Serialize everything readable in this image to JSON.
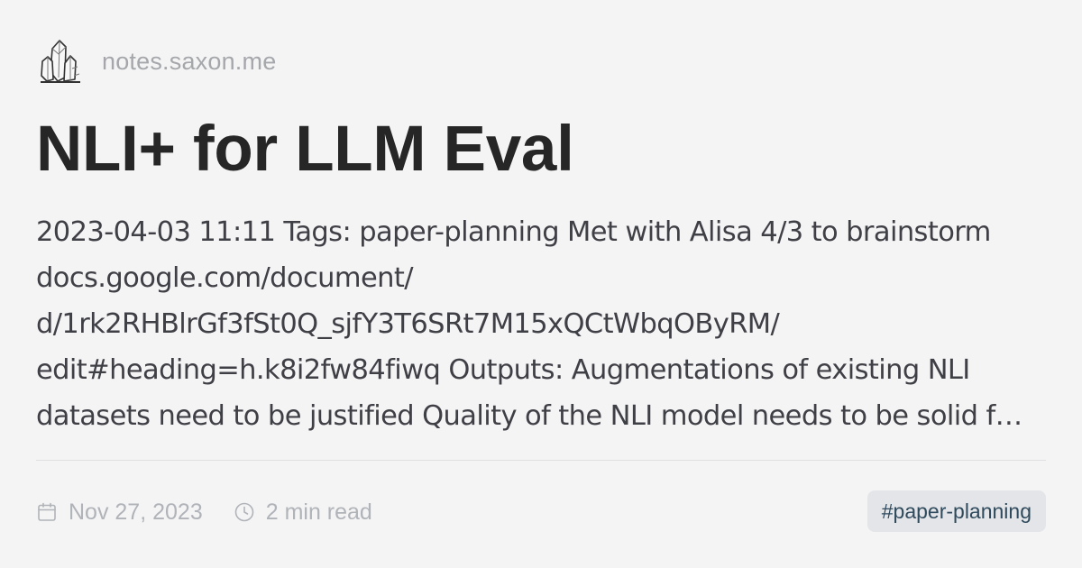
{
  "site": {
    "name": "notes.saxon.me",
    "logo_icon": "crystal-cluster-icon"
  },
  "post": {
    "title": "NLI+ for LLM Eval",
    "excerpt": "2023-04-03 11:11 Tags: paper-planning Met with Alisa 4/3 to brainstorm docs.google.com/document/ d/1rk2RHBlrGf3fSt0Q_sjfY3T6SRt7M15xQCtWbqOByRM/ edit#heading=h.k8i2fw84fiwq Outputs: Augmentations of existing NLI datasets need to be justified Quality of the NLI model needs to be solid f…",
    "date": "Nov 27, 2023",
    "date_icon": "calendar-icon",
    "read_time": "2 min read",
    "read_time_icon": "clock-icon",
    "tag": "#paper-planning"
  },
  "colors": {
    "background": "#f4f4f5",
    "title": "#262626",
    "body_text": "#3f3f46",
    "muted": "#a5a7ab",
    "tag_background": "#e3e5e8",
    "tag_text": "#2f4a5c"
  }
}
